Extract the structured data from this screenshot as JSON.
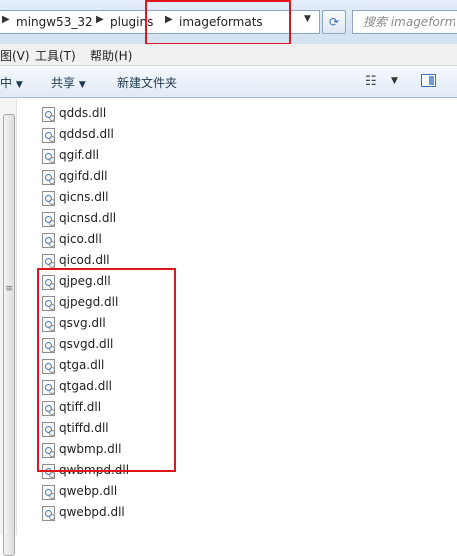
{
  "address_bar": {
    "breadcrumb": [
      "mingw53_32",
      "plugins",
      "imageformats"
    ],
    "search_placeholder": "搜索 imageformats"
  },
  "menu": {
    "view": "图(V)",
    "tools": "工具(T)",
    "help": "帮助(H)"
  },
  "toolbar": {
    "organize_fragment": "中",
    "share": "共享",
    "new_folder": "新建文件夹"
  },
  "files": [
    "qdds.dll",
    "qddsd.dll",
    "qgif.dll",
    "qgifd.dll",
    "qicns.dll",
    "qicnsd.dll",
    "qico.dll",
    "qicod.dll",
    "qjpeg.dll",
    "qjpegd.dll",
    "qsvg.dll",
    "qsvgd.dll",
    "qtga.dll",
    "qtgad.dll",
    "qtiff.dll",
    "qtiffd.dll",
    "qwbmp.dll",
    "qwbmpd.dll",
    "qwebp.dll",
    "qwebpd.dll"
  ],
  "highlight_color": "#e0161b",
  "icons": [
    "chevron-right-icon",
    "dropdown-arrow-icon",
    "refresh-icon",
    "view-options-icon",
    "preview-pane-icon",
    "dll-file-icon",
    "scrollbar-grip-icon"
  ]
}
